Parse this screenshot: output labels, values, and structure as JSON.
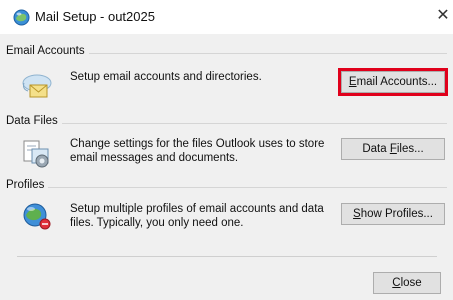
{
  "window": {
    "title": "Mail Setup - out2025",
    "close_glyph": "✕"
  },
  "sections": [
    {
      "heading": "Email Accounts",
      "description": "Setup email accounts and directories.",
      "icon": "mail-envelope-icon",
      "button": {
        "accel": "E",
        "rest": "mail Accounts...",
        "highlighted": true
      }
    },
    {
      "heading": "Data Files",
      "description": "Change settings for the files Outlook uses to store email messages and documents.",
      "icon": "data-files-icon",
      "button": {
        "pre": "Data ",
        "accel": "F",
        "rest": "iles..."
      }
    },
    {
      "heading": "Profiles",
      "description": "Setup multiple profiles of email accounts and data files. Typically, you only need one.",
      "icon": "profiles-globe-icon",
      "button": {
        "accel": "S",
        "rest": "how Profiles..."
      }
    }
  ],
  "footer": {
    "close_button": {
      "accel": "C",
      "rest": "lose"
    }
  },
  "colors": {
    "highlight_border": "#e0001b",
    "dialog_background": "#f0f0f0"
  }
}
